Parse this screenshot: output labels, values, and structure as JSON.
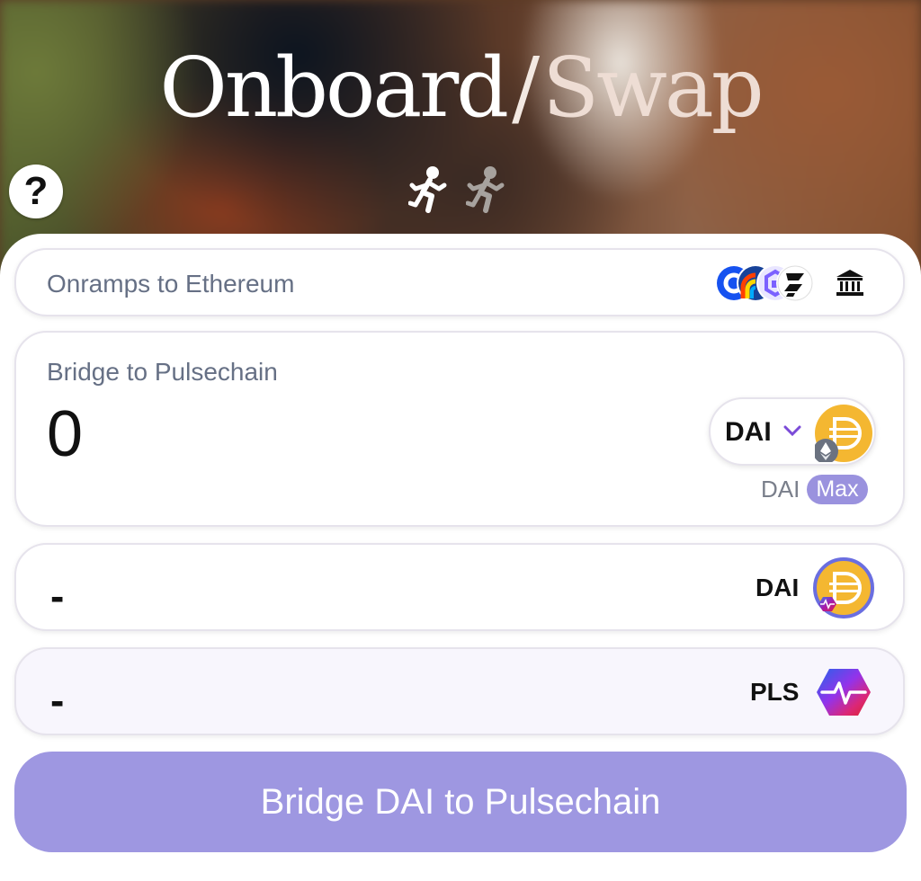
{
  "header": {
    "title_left": "Onboard",
    "title_sep": "/",
    "title_right": "Swap",
    "help_label": "?",
    "steps": [
      "runner-step-1-active",
      "runner-step-2-inactive"
    ]
  },
  "onramp": {
    "label": "Onramps to Ethereum",
    "provider_icons": [
      "coinbase-icon",
      "rainbow-icon",
      "kraken-icon",
      "stripe-icon"
    ],
    "bank_icon": "bank-icon"
  },
  "bridge": {
    "label": "Bridge to Pulsechain",
    "amount": "0",
    "token": "DAI",
    "balance_symbol": "DAI",
    "max_label": "Max"
  },
  "outputs": [
    {
      "amount": "-",
      "symbol": "DAI"
    },
    {
      "amount": "-",
      "symbol": "PLS"
    }
  ],
  "cta": {
    "label": "Bridge DAI to Pulsechain"
  },
  "colors": {
    "accent": "#9e97e1",
    "dai": "#f4b731",
    "pls_start": "#4f46e5",
    "pls_end": "#e11d48"
  }
}
